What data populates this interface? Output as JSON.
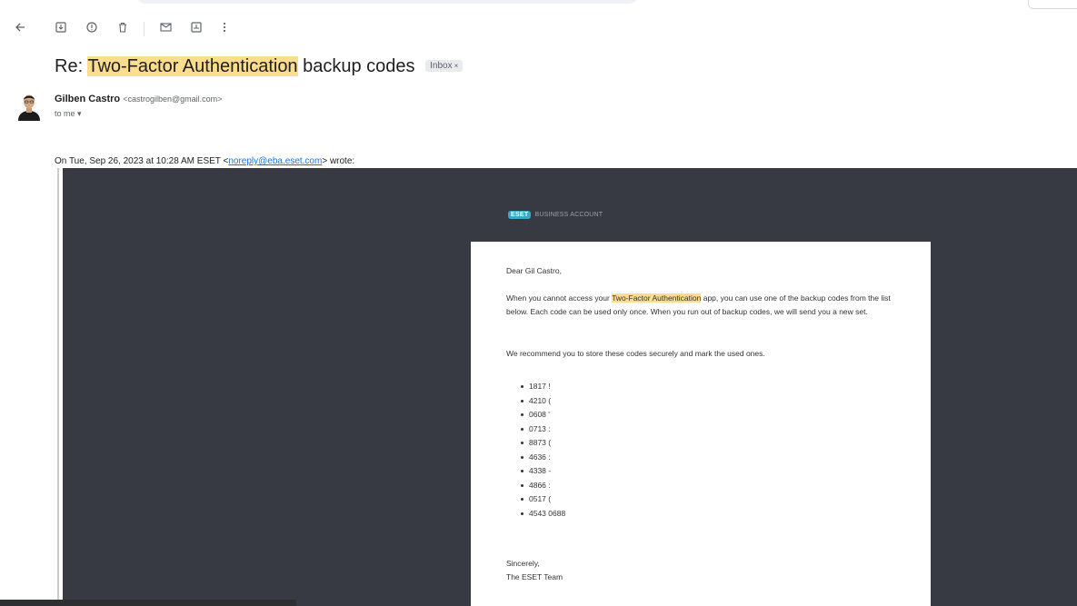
{
  "toolbar": {
    "back_icon": "arrow-left-icon",
    "archive_icon": "archive-icon",
    "report_spam_icon": "report-icon",
    "delete_icon": "trash-icon",
    "mark_unread_icon": "mail-icon",
    "move_icon": "move-to-icon",
    "more_icon": "more-vertical-icon"
  },
  "subject": {
    "prefix": "Re: ",
    "highlight": "Two-Factor Authentication",
    "suffix": " backup codes",
    "badge": "Inbox"
  },
  "sender": {
    "name": "Gilben Castro",
    "email": "<castrogilben@gmail.com>",
    "to": "to me"
  },
  "quote_header": {
    "before": "On Tue, Sep 26, 2023 at 10:28 AM ESET <",
    "link": "noreply@eba.eset.com",
    "after": "> wrote:"
  },
  "eset": {
    "logo_text": "ESET",
    "business_label": "BUSINESS ACCOUNT",
    "greeting": "Dear Gil Castro,",
    "para1_before": "When you cannot access your ",
    "para1_highlight": "Two-Factor Authentication",
    "para1_after": " app, you can use one of the backup codes from the list below. Each code can be used only once. When you run out of backup codes, we will send you a new set.",
    "para2": "We recommend you to store these codes securely and mark the used ones.",
    "codes": [
      "1817 !",
      "4210 (",
      "0608 '",
      "0713 :",
      "8873 (",
      "4636 :",
      "4338 -",
      "4866 :",
      "0517 (",
      "4543 0688"
    ],
    "closing": "Sincerely,",
    "signature": "The ESET Team"
  },
  "colors": {
    "highlight": "#fcdc8d",
    "eset_background": "#373a42",
    "link": "#1a73e8",
    "eset_brand": "#3ba8c6"
  }
}
